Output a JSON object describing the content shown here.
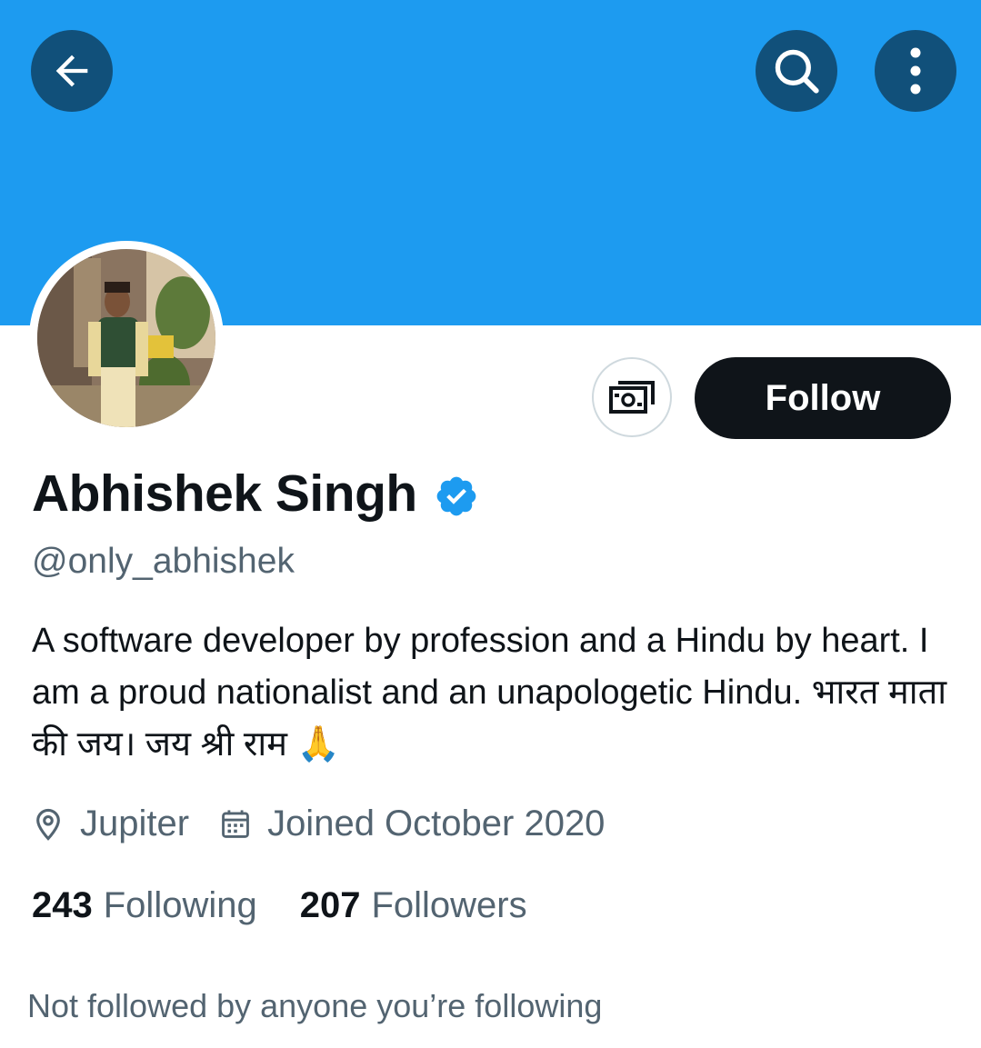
{
  "header": {
    "banner_color": "#1d9bf0",
    "back_icon": "arrow-left-icon",
    "search_icon": "search-icon",
    "more_icon": "more-vertical-icon"
  },
  "actions": {
    "tip_icon": "money-tip-icon",
    "follow_label": "Follow"
  },
  "profile": {
    "name": "Abhishek Singh",
    "verified_icon": "verified-badge-icon",
    "handle": "@only_abhishek",
    "bio": "A software developer by profession and a Hindu by heart. I am a proud nationalist and an unapologetic Hindu. भारत माता की जय। जय श्री राम 🙏",
    "location": "Jupiter",
    "joined": "Joined October 2020"
  },
  "stats": {
    "following_count": "243",
    "following_label": "Following",
    "followers_count": "207",
    "followers_label": "Followers"
  },
  "social_context": "Not followed by anyone you’re following"
}
